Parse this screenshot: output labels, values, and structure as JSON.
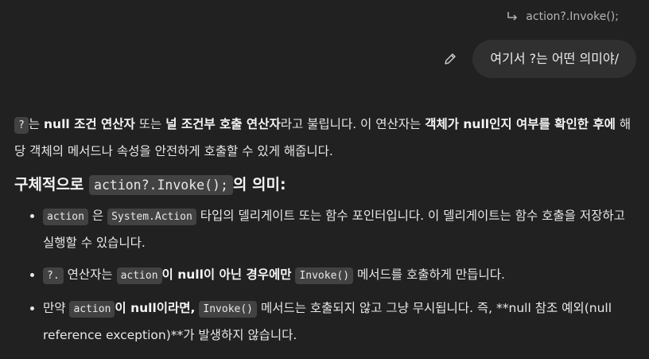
{
  "user": {
    "quote": "action?.Invoke();",
    "message": "여기서 ?는 어떤 의미야/"
  },
  "response": {
    "intro": {
      "code_q": "?",
      "t1": "는 ",
      "b1": "null 조건 연산자",
      "t2": " 또는 ",
      "b2": "널 조건부 호출 연산자",
      "t3": "라고 불립니다. 이 연산자는 ",
      "b3": "객체가 null인지 여부를 확인한 후에",
      "t4": " 해당 객체의 메서드나 속성을 안전하게 호출할 수 있게 해줍니다."
    },
    "heading": {
      "prefix": "구체적으로 ",
      "code": "action?.Invoke();",
      "suffix": "의 의미:"
    },
    "bullets": {
      "b1": {
        "code1": "action",
        "t1": " 은 ",
        "code2": "System.Action",
        "t2": " 타입의 델리게이트 또는 함수 포인터입니다. 이 델리게이트는 함수 호출을 저장하고 실행할 수 있습니다."
      },
      "b2": {
        "code1": "?.",
        "t1": " 연산자는 ",
        "code2": "action",
        "bold": "이 null이 아닌 경우에만",
        "t2": " ",
        "code3": "Invoke()",
        "t3": " 메서드를 호출하게 만듭니다."
      },
      "b3": {
        "t1": "만약 ",
        "code1": "action",
        "bold": "이 null이라면,",
        "t2": " ",
        "code2": "Invoke()",
        "t3": " 메서드는 호출되지 않고 그냥 무시됩니다. 즉, **null 참조 예외(null reference exception)**가 발생하지 않습니다."
      }
    }
  },
  "icons": {
    "reply": "reply-arrow-icon",
    "edit": "pencil-icon"
  }
}
